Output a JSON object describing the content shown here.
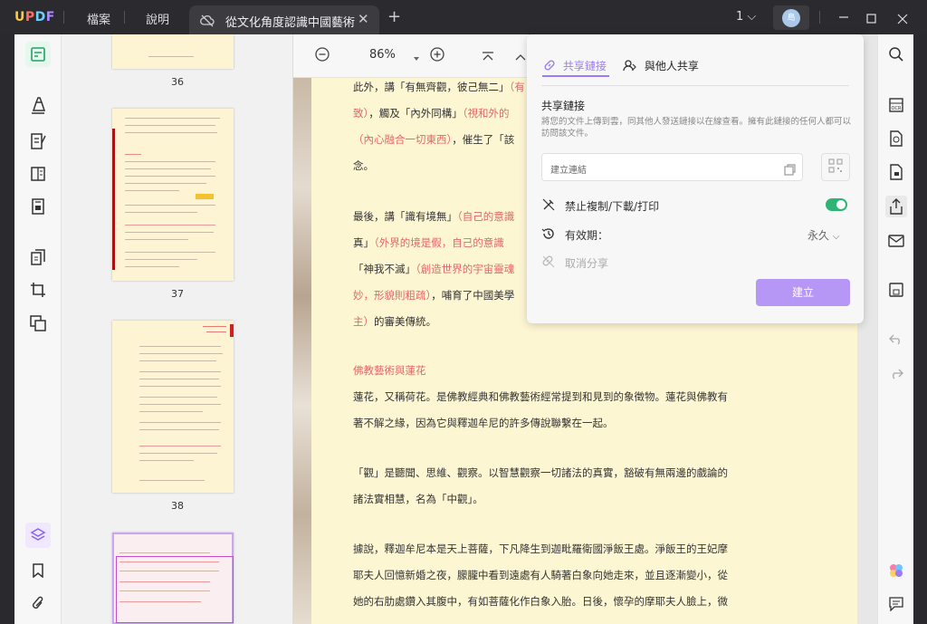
{
  "app": {
    "logo": "UPDF",
    "menu": [
      "檔案",
      "說明"
    ],
    "tab_title": "從文化角度認識中國藝術",
    "page_count": "1",
    "avatar_text": "島"
  },
  "viewer": {
    "zoom": "86%"
  },
  "thumbnails": [
    {
      "page": "36"
    },
    {
      "page": "37"
    },
    {
      "page": "38"
    }
  ],
  "document": {
    "lines": [
      {
        "parts": [
          {
            "t": "此外，講「有無齊觀，彼己無二」"
          },
          {
            "t": "（有",
            "red": true
          }
        ]
      },
      {
        "parts": [
          {
            "t": "致）",
            "red": true
          },
          {
            "t": "，觸及「內外同構」"
          },
          {
            "t": "（視和外的",
            "red": true
          }
        ]
      },
      {
        "parts": [
          {
            "t": "（內心融合一切東西）",
            "red": true
          },
          {
            "t": "，催生了「該"
          }
        ]
      },
      {
        "parts": [
          {
            "t": "念。"
          }
        ]
      },
      {
        "parts": [
          {
            "t": "最後，講「識有境無」"
          },
          {
            "t": "（自己的意識",
            "red": true
          }
        ]
      },
      {
        "parts": [
          {
            "t": "真」"
          },
          {
            "t": "（外界的境是假，自己的意識",
            "red": true
          }
        ]
      },
      {
        "parts": [
          {
            "t": "「神我不滅」"
          },
          {
            "t": "（創造世界的宇宙靈魂",
            "red": true
          }
        ]
      },
      {
        "parts": [
          {
            "t": "妙，形貌則粗疏）",
            "red": true
          },
          {
            "t": "，哺育了中國美學"
          }
        ]
      },
      {
        "parts": [
          {
            "t": "主）",
            "red": true
          },
          {
            "t": "的審美傳統。"
          }
        ]
      },
      {
        "parts": [
          {
            "t": "佛教藝術與蓮花",
            "red": true
          }
        ]
      },
      {
        "parts": [
          {
            "t": "蓮花，又稱荷花。是佛教經典和佛教藝術經常提到和見到的象徵物。蓮花與佛教有"
          }
        ]
      },
      {
        "parts": [
          {
            "t": "著不解之緣，因為它與釋迦牟尼的許多傳說聯繫在一起。"
          }
        ]
      },
      {
        "parts": [
          {
            "t": "「觀」是聽聞、思維、觀察。以智慧觀察一切諸法的真實，豁破有無兩邊的戲論的"
          }
        ]
      },
      {
        "parts": [
          {
            "t": "諸法實相慧，名為「中觀」。"
          }
        ]
      },
      {
        "parts": [
          {
            "t": "據說，釋迦牟尼本是天上菩薩，下凡降生到迦毗羅衛國淨飯王處。淨飯王的王妃摩"
          }
        ]
      },
      {
        "parts": [
          {
            "t": "耶夫人回憶新婚之夜，朦朧中看到遠處有人騎著白象向她走來，並且逐漸變小，從"
          }
        ]
      },
      {
        "parts": [
          {
            "t": "她的右肋處鑽入其腹中，有如菩薩化作白象入胎。日後，懷孕的摩耶夫人臉上，微"
          }
        ]
      }
    ]
  },
  "share": {
    "tab_link": "共享鏈接",
    "tab_people": "與他人共享",
    "heading": "共享鏈接",
    "description": "將您的文件上傳到雲，同其他人發送鏈接以在線查看。擁有此鏈接的任何人都可以訪問該文件。",
    "link_placeholder": "建立連結",
    "prevent_copy": "禁止複制/下載/打印",
    "expiry_label": "有效期：",
    "expiry_value": "永久",
    "cancel_share": "取消分享",
    "create_button": "建立"
  },
  "colors": {
    "accent": "#9c7cf5",
    "toggle_on": "#2fb475",
    "page_bg": "#fdf6d3",
    "red_text": "#e46767"
  }
}
